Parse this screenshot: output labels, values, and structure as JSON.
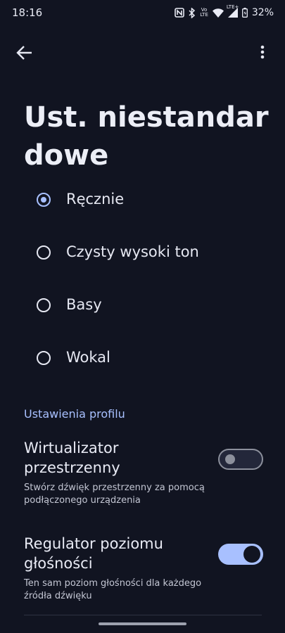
{
  "status_bar": {
    "time": "18:16",
    "volte_label": "Vo",
    "lte_label": "LTE",
    "lte_plus_label": "LTE+",
    "battery": "32%",
    "icons": [
      "nfc-icon",
      "bluetooth-icon",
      "volte-icon",
      "wifi-icon",
      "signal-icon",
      "battery-icon"
    ]
  },
  "app_bar": {
    "back_icon": "arrow-back-icon",
    "more_icon": "more-vert-icon"
  },
  "title": "Ust. niestandardowe",
  "presets": {
    "selected_index": 0,
    "options": [
      {
        "label": "Ręcznie",
        "checked": true
      },
      {
        "label": "Czysty wysoki ton",
        "checked": false
      },
      {
        "label": "Basy",
        "checked": false
      },
      {
        "label": "Wokal",
        "checked": false
      }
    ]
  },
  "profile_section": {
    "header": "Ustawienia profilu",
    "settings": [
      {
        "title": "Wirtualizator przestrzenny",
        "subtitle": "Stwórz dźwięk przestrzenny za pomocą podłączonego urządzenia",
        "enabled": false
      },
      {
        "title": "Regulator poziomu głośności",
        "subtitle": "Ten sam poziom głośności dla każdego źródła dźwięku",
        "enabled": true
      }
    ]
  },
  "colors": {
    "background": "#111421",
    "accent": "#a8c0ff",
    "text": "#e6e8f2"
  }
}
